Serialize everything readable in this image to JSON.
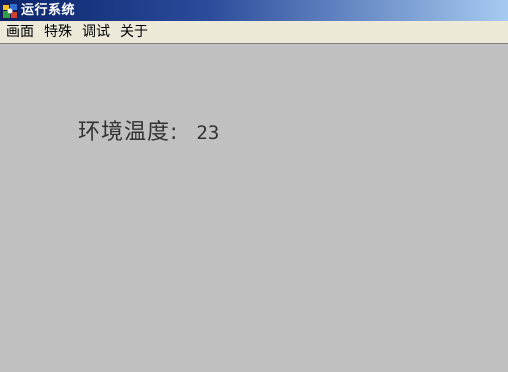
{
  "window": {
    "title": "运行系统",
    "app_icon": "app-icon"
  },
  "menu": {
    "items": [
      {
        "label": "画面"
      },
      {
        "label": "特殊"
      },
      {
        "label": "调试"
      },
      {
        "label": "关于"
      }
    ]
  },
  "main": {
    "temperature": {
      "label": "环境温度:",
      "value": "23"
    }
  },
  "colors": {
    "title_bar_start": "#0a246a",
    "title_bar_end": "#a6caf0",
    "menu_bg": "#ece9d8",
    "client_bg": "#c0c0c0",
    "text": "#333333"
  }
}
